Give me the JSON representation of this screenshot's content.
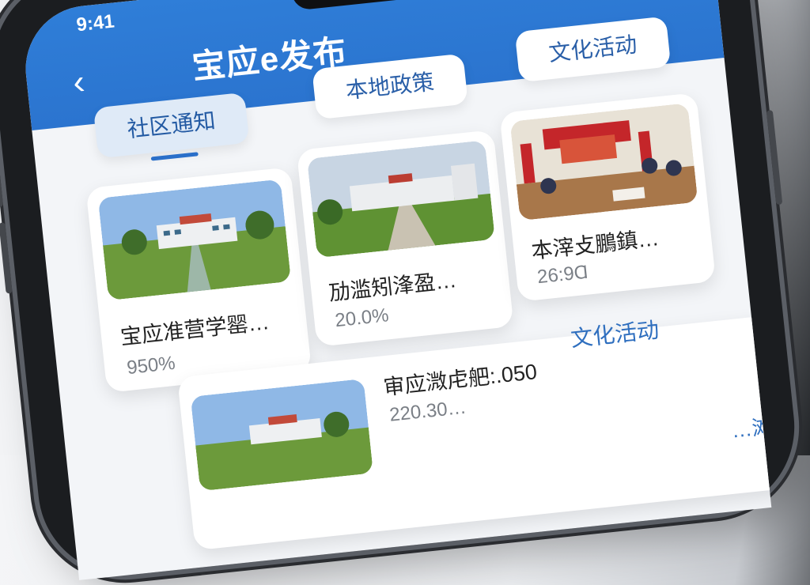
{
  "status": {
    "time": "9:41"
  },
  "header": {
    "title": "宝应e发布",
    "back_icon": "chevron-left-icon"
  },
  "tabs": [
    {
      "label": "社区通知",
      "active": true
    },
    {
      "label": "本地政策",
      "active": false
    },
    {
      "label": "文化活动",
      "active": false
    }
  ],
  "cards": [
    {
      "title": "宝应准营学罂…",
      "meta": "950%",
      "image": "school-campus-photo"
    },
    {
      "title": "劢滥矧浲盈…",
      "meta": "20.0%",
      "image": "school-building-photo"
    },
    {
      "title": "本滓攴鵬鎮…",
      "meta": "26:9Ɑ",
      "image": "meeting-room-photo"
    }
  ],
  "list_item": {
    "title": "审应溦虍舥:.050",
    "meta": "220.30…",
    "tag": "文化活动",
    "image": "school-campus-photo"
  },
  "footer_peek": {
    "text": "…滩财"
  },
  "colors": {
    "primary": "#2f7ed8",
    "accent_text": "#2f6fbf",
    "background": "#f3f5f8"
  }
}
